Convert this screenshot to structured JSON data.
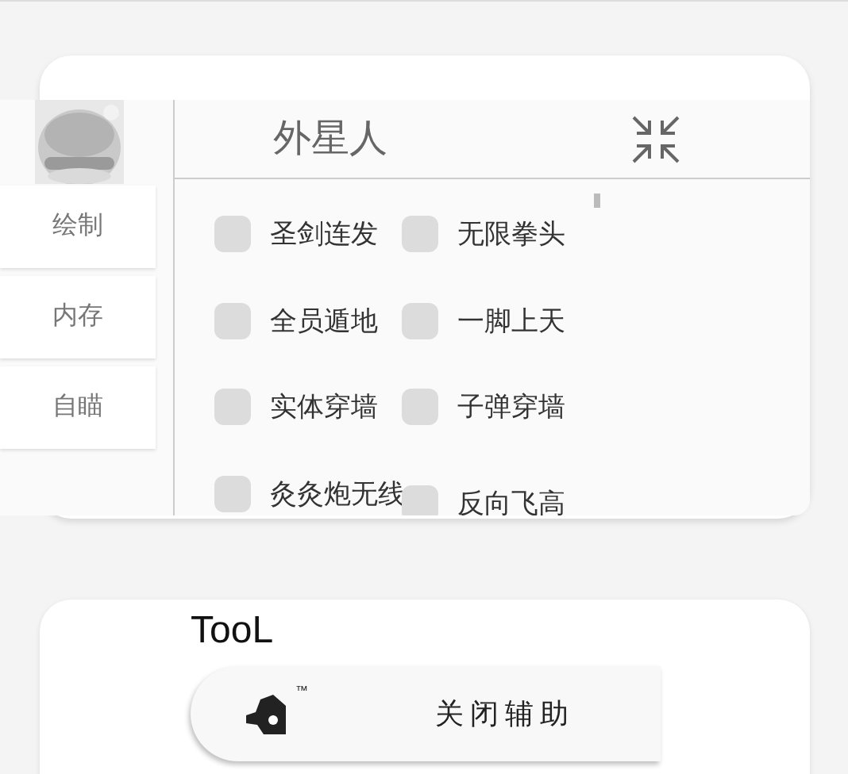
{
  "menu": {
    "tabs": [
      {
        "label": "绘制",
        "selected": false
      },
      {
        "label": "内存",
        "selected": false
      },
      {
        "label": "自瞄",
        "selected": false
      }
    ]
  },
  "panel": {
    "title": "外星人",
    "options": [
      {
        "label": "圣剑连发",
        "checked": false
      },
      {
        "label": "无限拳头",
        "checked": false
      },
      {
        "label": "全员遁地",
        "checked": false
      },
      {
        "label": "一脚上天",
        "checked": false
      },
      {
        "label": "实体穿墙",
        "checked": false
      },
      {
        "label": "子弹穿墙",
        "checked": false
      },
      {
        "label": "灸灸炮无线",
        "checked": false
      },
      {
        "label": "反向飞高",
        "checked": false
      }
    ]
  },
  "tool_card": {
    "title": "TooL",
    "button": {
      "label": "关闭辅助",
      "superscript": "™"
    }
  }
}
